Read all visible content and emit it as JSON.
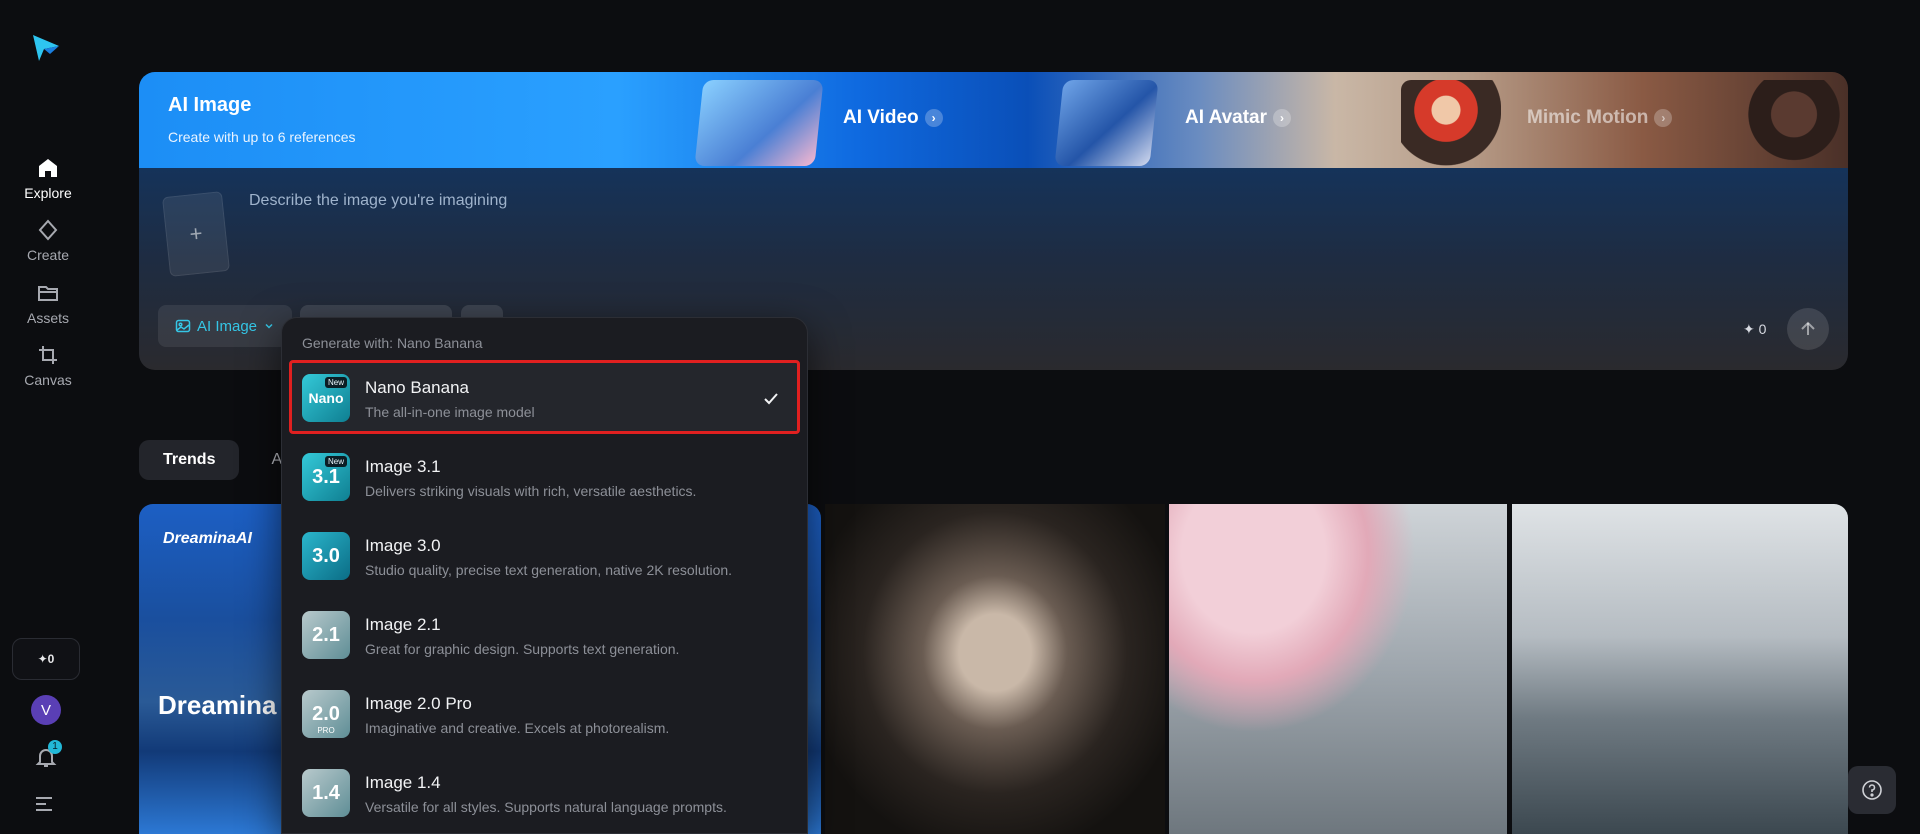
{
  "sidebar": {
    "nav": [
      {
        "label": "Explore",
        "icon": "home-icon"
      },
      {
        "label": "Create",
        "icon": "diamond-icon"
      },
      {
        "label": "Assets",
        "icon": "folder-icon"
      },
      {
        "label": "Canvas",
        "icon": "crop-icon"
      }
    ],
    "credits": "✦0",
    "avatar_initial": "V",
    "notification_count": "1"
  },
  "banner": {
    "title": "AI Image",
    "subtitle": "Create with up to 6 references",
    "links": [
      {
        "label": "AI Video"
      },
      {
        "label": "AI Avatar"
      },
      {
        "label": "Mimic Motion"
      }
    ]
  },
  "prompt": {
    "placeholder": "Describe the image you're imagining",
    "mode_label": "AI Image",
    "credits": "✦ 0"
  },
  "tabs": [
    "Trends",
    "A"
  ],
  "gallery": {
    "tile1_logo": "DreaminaAI",
    "tile1_title": "Dreamina A"
  },
  "dropdown": {
    "header": "Generate with: Nano Banana",
    "items": [
      {
        "name": "Nano Banana",
        "desc": "The all-in-one image model",
        "icon_text": "Nano",
        "tag": "New",
        "selected": true
      },
      {
        "name": "Image 3.1",
        "desc": "Delivers striking visuals with rich, versatile aesthetics.",
        "icon_text": "3.1",
        "tag": "New"
      },
      {
        "name": "Image 3.0",
        "desc": "Studio quality, precise text generation, native 2K resolution.",
        "icon_text": "3.0"
      },
      {
        "name": "Image 2.1",
        "desc": "Great for graphic design. Supports text generation.",
        "icon_text": "2.1"
      },
      {
        "name": "Image 2.0 Pro",
        "desc": "Imaginative and creative. Excels at photorealism.",
        "icon_text": "2.0",
        "tag2": "PRO"
      },
      {
        "name": "Image 1.4",
        "desc": "Versatile for all styles. Supports natural language prompts.",
        "icon_text": "1.4"
      }
    ]
  },
  "colors": {
    "accent": "#35c6e6",
    "selection_outline": "#e02020",
    "background": "#0c0d10"
  }
}
